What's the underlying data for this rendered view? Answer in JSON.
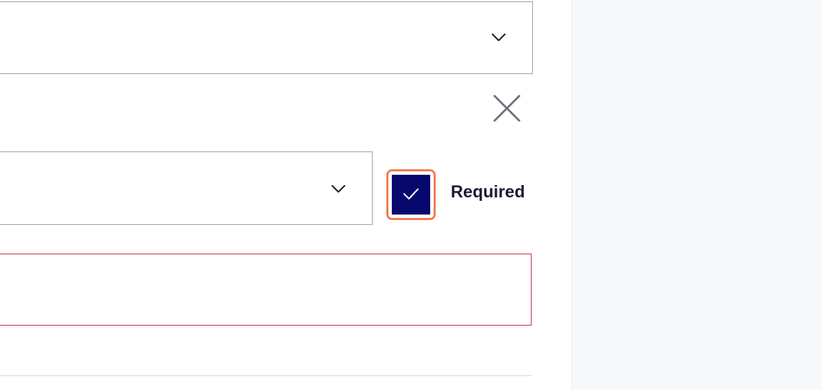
{
  "form": {
    "select_top": {
      "value": "",
      "icon": "chevron-down-icon"
    },
    "remove_button": {
      "icon": "close-icon"
    },
    "select_type": {
      "value": "",
      "icon": "chevron-down-icon"
    },
    "required_checkbox": {
      "checked": true,
      "label": "Required",
      "icon": "checkmark-icon"
    },
    "text_field": {
      "value": "",
      "state": "error"
    }
  },
  "colors": {
    "checkbox_fill": "#06086d",
    "focus_ring": "#f47a4c",
    "error_border": "#c0283a",
    "side_panel": "#f7f8fb"
  }
}
